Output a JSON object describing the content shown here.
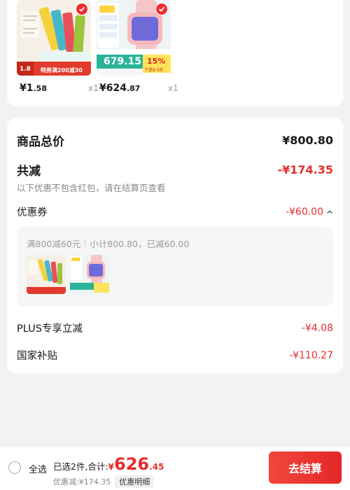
{
  "colors": {
    "accent": "#e82c2c",
    "background": "#f2f2f2"
  },
  "products": [
    {
      "price_main": "¥1",
      "price_cents": ".58",
      "qty": "x1",
      "badge": "特券满200减30",
      "mini_price": "1.8"
    },
    {
      "price_main": "¥624",
      "price_cents": ".87",
      "qty": "x1",
      "price_tag": "679.15",
      "percent": "15%",
      "sub_tag": "下单8.5折"
    }
  ],
  "summary": {
    "goods_total_label": "商品总价",
    "goods_total_value": "¥800.80",
    "total_reduction_label": "共减",
    "total_reduction_value": "-¥174.35",
    "note": "以下优惠不包含红包，请在结算页查看",
    "coupon_label": "优惠券",
    "coupon_value": "-¥60.00",
    "coupon_rule": "满800减60元",
    "coupon_detail": "小计800.80，已减60.00",
    "plus_label": "PLUS专享立减",
    "plus_value": "-¥4.08",
    "subsidy_label": "国家补贴",
    "subsidy_value": "-¥110.27"
  },
  "bottom_bar": {
    "select_all": "全选",
    "selected_text": "已选2件,合计:",
    "currency": "¥",
    "total_main": "626",
    "total_cents": ".45",
    "discount_text": "优惠减:¥174.35",
    "detail_button": "优惠明细",
    "checkout_button": "去结算"
  }
}
